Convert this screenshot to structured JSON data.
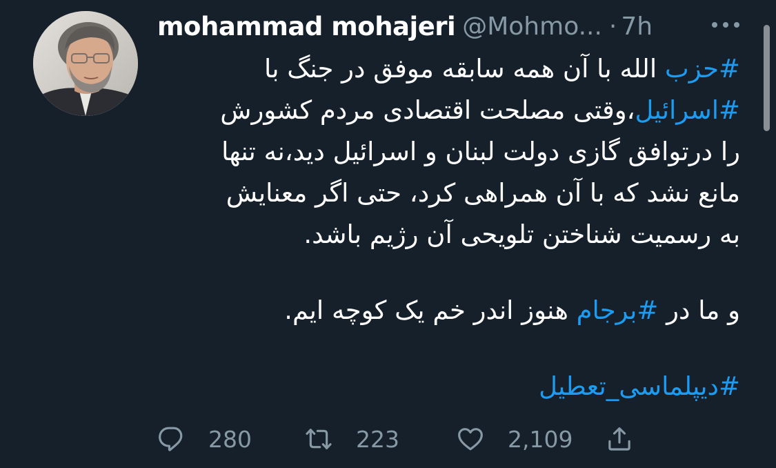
{
  "tweet": {
    "display_name": "mohammad mohajeri",
    "handle": "@Mohmo...",
    "separator": "·",
    "time": "7h",
    "body": {
      "line1_hashtag": "#حزب",
      "line1_text": " الله با آن همه سابقه موفق در جنگ با",
      "line2_hashtag": "#اسرائیل",
      "line2_text": "،وقتی مصلحت اقتصادی مردم کشورش",
      "line3_text": "را درتوافق گازی دولت لبنان و اسرائیل دید،نه تنها",
      "line4_text": "مانع نشد که با آن همراهی کرد، حتی اگر معنایش",
      "line5_text": "به رسمیت شناختن تلویحی آن رژیم باشد.",
      "line6_prefix": "و ما در ",
      "line6_hashtag": "#برجام",
      "line6_suffix": " هنوز اندر خم یک کوچه ایم.",
      "line7_hashtag": "#دیپلماسی_تعطیل"
    },
    "metrics": {
      "replies": "280",
      "retweets": "223",
      "likes": "2,109"
    }
  },
  "icons": {
    "more": "more-dots-icon",
    "reply": "reply-icon",
    "retweet": "retweet-icon",
    "like": "heart-icon",
    "share": "share-icon"
  },
  "colors": {
    "background": "#15202b",
    "text": "#ffffff",
    "secondary": "#8899a6",
    "link": "#1d9bf0"
  }
}
